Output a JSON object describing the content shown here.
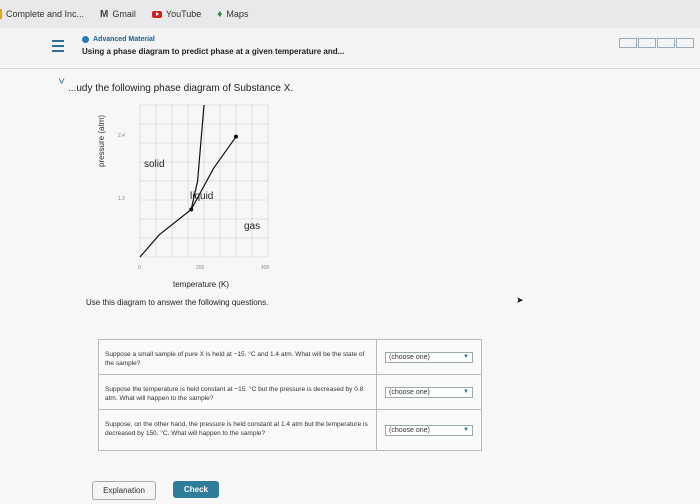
{
  "bookmarks": [
    {
      "label": "Complete and Inc...",
      "icon": "document-icon"
    },
    {
      "label": "Gmail",
      "icon": "gmail-icon"
    },
    {
      "label": "YouTube",
      "icon": "youtube-icon"
    },
    {
      "label": "Maps",
      "icon": "maps-pin-icon"
    }
  ],
  "header": {
    "tag": "Advanced Material",
    "title": "Using a phase diagram to predict phase at a given temperature and..."
  },
  "intro": "...udy the following phase diagram of Substance X.",
  "chart_data": {
    "type": "line",
    "ylabel": "pressure (atm)",
    "xlabel": "temperature (K)",
    "x_ticks": [
      "0",
      "200",
      "400"
    ],
    "y_ticks": [
      "2.4",
      "1.2"
    ],
    "regions": [
      "solid",
      "liquid",
      "gas"
    ],
    "series": [
      {
        "x": [
          0,
          60,
          160
        ],
        "y": [
          0,
          0.35,
          0.75
        ]
      },
      {
        "x": [
          160,
          180,
          200
        ],
        "y": [
          0.75,
          1.2,
          2.4
        ]
      },
      {
        "x": [
          160,
          230,
          300
        ],
        "y": [
          0.75,
          1.4,
          1.9
        ]
      }
    ],
    "xlim": [
      0,
      400
    ],
    "ylim": [
      0,
      2.4
    ],
    "grid": true
  },
  "use_text": "Use this diagram to answer the following questions.",
  "questions": [
    {
      "text": "Suppose a small sample of pure X is held at −15. °C and 1.4 atm. What will be the state of the sample?",
      "select": "(choose one)"
    },
    {
      "text": "Suppose the temperature is held constant at −15. °C but the pressure is decreased by 0.8 atm. What will happen to the sample?",
      "select": "(choose one)"
    },
    {
      "text": "Suppose, on the other hand, the pressure is held constant at 1.4 atm but the temperature is decreased by 150. °C. What will happen to the sample?",
      "select": "(choose one)"
    }
  ],
  "buttons": {
    "explanation": "Explanation",
    "check": "Check"
  }
}
